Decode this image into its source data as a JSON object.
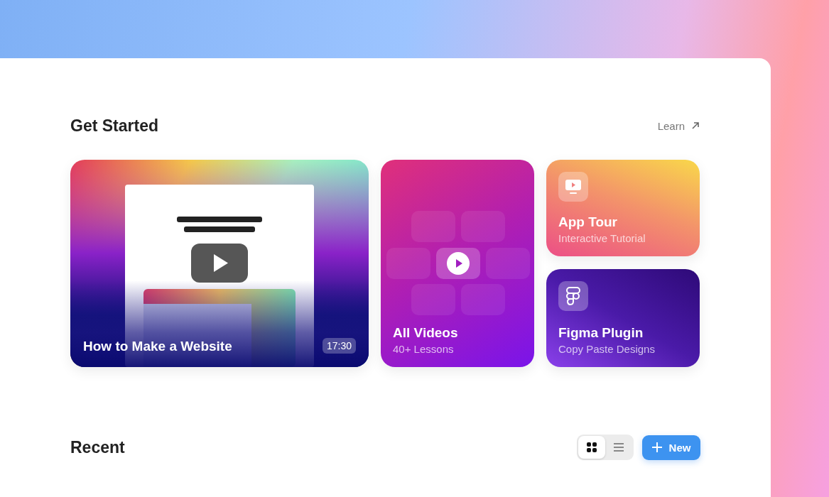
{
  "header": {
    "title": "Get Started",
    "link": "Learn"
  },
  "featured": {
    "kind": "picture",
    "title": "How to Make a Website",
    "duration": "17:30"
  },
  "cards": [
    {
      "kind": "videos",
      "title": "All Videos",
      "subtitle": "40+ Lessons"
    },
    {
      "kind": "tour",
      "title": "App Tour",
      "subtitle": "Interactive Tutorial"
    },
    {
      "kind": "plugin",
      "title": "Figma Plugin",
      "subtitle": "Copy Paste Designs"
    }
  ],
  "recent": {
    "title": "Recent",
    "views": [
      {
        "kind": "grid",
        "selected": true
      },
      {
        "kind": "list",
        "selected": false
      }
    ],
    "new_button": "New"
  }
}
